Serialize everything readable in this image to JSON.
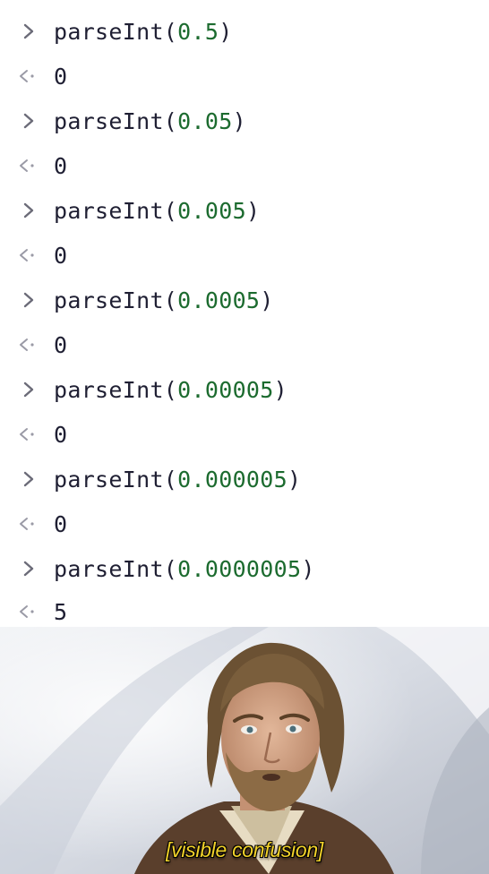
{
  "console": {
    "entries": [
      {
        "input_fn": "parseInt(",
        "input_arg": "0.5",
        "input_close": ")",
        "output": "0"
      },
      {
        "input_fn": "parseInt(",
        "input_arg": "0.05",
        "input_close": ")",
        "output": "0"
      },
      {
        "input_fn": "parseInt(",
        "input_arg": "0.005",
        "input_close": ")",
        "output": "0"
      },
      {
        "input_fn": "parseInt(",
        "input_arg": "0.0005",
        "input_close": ")",
        "output": "0"
      },
      {
        "input_fn": "parseInt(",
        "input_arg": "0.00005",
        "input_close": ")",
        "output": "0"
      },
      {
        "input_fn": "parseInt(",
        "input_arg": "0.000005",
        "input_close": ")",
        "output": "0"
      },
      {
        "input_fn": "parseInt(",
        "input_arg": "0.0000005",
        "input_close": ")",
        "output": "5"
      }
    ],
    "icons": {
      "input_prompt": "chevron-right-icon",
      "output_prompt": "return-arrow-icon"
    },
    "colors": {
      "text": "#1f1f33",
      "number": "#1c6b2f",
      "prompt": "#6b6b78"
    }
  },
  "meme": {
    "caption": "[visible confusion]",
    "caption_color": "#f2d22a"
  }
}
